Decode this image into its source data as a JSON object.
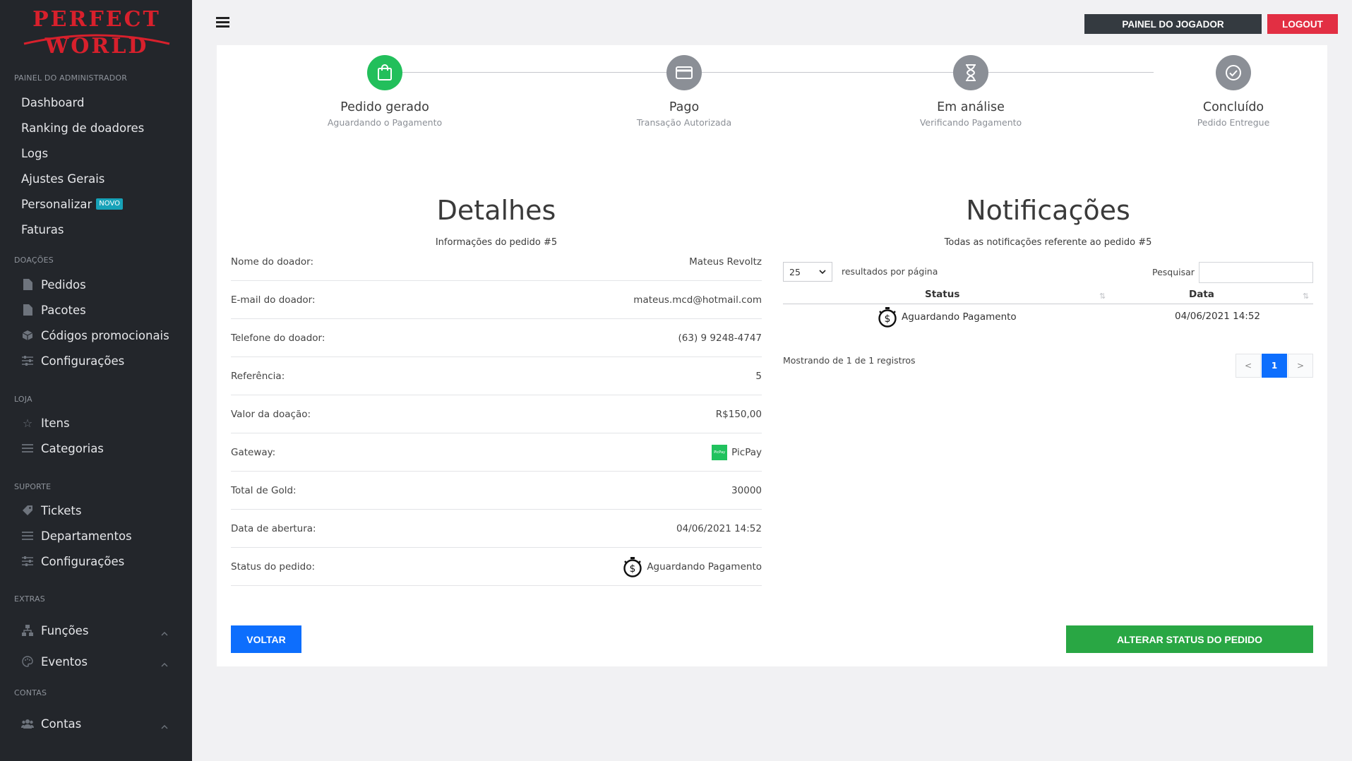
{
  "logo": {
    "line1": "PERFECT",
    "line2": "WORLD"
  },
  "sidebar": {
    "sections": {
      "admin": "PAINEL DO ADMINISTRADOR",
      "doacoes": "DOAÇÕES",
      "loja": "LOJA",
      "suporte": "SUPORTE",
      "extras": "EXTRAS",
      "contas": "CONTAS"
    },
    "admin_items": [
      "Dashboard",
      "Ranking de doadores",
      "Logs",
      "Ajustes Gerais",
      "Personalizar",
      "Faturas"
    ],
    "new_badge": "NOVO",
    "doacoes_items": [
      "Pedidos",
      "Pacotes",
      "Códigos promocionais",
      "Configurações"
    ],
    "loja_items": [
      "Itens",
      "Categorias"
    ],
    "suporte_items": [
      "Tickets",
      "Departamentos",
      "Configurações"
    ],
    "extras_items": [
      "Funções",
      "Eventos"
    ],
    "contas_items": [
      "Contas"
    ]
  },
  "topbar": {
    "player_panel": "PAINEL DO JOGADOR",
    "logout": "LOGOUT"
  },
  "steps": [
    {
      "title": "Pedido gerado",
      "subtitle": "Aguardando o Pagamento",
      "icon": "shopping-bag-icon",
      "active": true
    },
    {
      "title": "Pago",
      "subtitle": "Transação Autorizada",
      "icon": "credit-card-icon",
      "active": false
    },
    {
      "title": "Em análise",
      "subtitle": "Verificando Pagamento",
      "icon": "hourglass-icon",
      "active": false
    },
    {
      "title": "Concluído",
      "subtitle": "Pedido Entregue",
      "icon": "check-circle-icon",
      "active": false
    }
  ],
  "details": {
    "title": "Detalhes",
    "subtitle": "Informações do pedido #5",
    "rows": [
      {
        "label": "Nome do doador:",
        "value": "Mateus Revoltz"
      },
      {
        "label": "E-mail do doador:",
        "value": "mateus.mcd@hotmail.com"
      },
      {
        "label": "Telefone do doador:",
        "value": "(63) 9 9248-4747"
      },
      {
        "label": "Referência:",
        "value": "5"
      },
      {
        "label": "Valor da doação:",
        "value": "R$150,00"
      },
      {
        "label": "Gateway:",
        "value": "PicPay"
      },
      {
        "label": "Total de Gold:",
        "value": "30000"
      },
      {
        "label": "Data de abertura:",
        "value": "04/06/2021 14:52"
      },
      {
        "label": "Status do pedido:",
        "value": "Aguardando Pagamento"
      }
    ],
    "picpay_logo_text": "PicPay"
  },
  "notifications": {
    "title": "Notificações",
    "subtitle": "Todas as notificações referente ao pedido #5",
    "page_size": "25",
    "per_page_label": "resultados por página",
    "search_label": "Pesquisar",
    "search_value": "",
    "columns": [
      "Status",
      "Data"
    ],
    "rows": [
      {
        "status": "Aguardando Pagamento",
        "date": "04/06/2021 14:52"
      }
    ],
    "info": "Mostrando de 1 de 1 registros",
    "pager": {
      "prev": "<",
      "current": "1",
      "next": ">"
    }
  },
  "actions": {
    "back": "VOLTAR",
    "change_status": "ALTERAR STATUS DO PEDIDO"
  },
  "colors": {
    "sidebar_bg": "#23262b",
    "step_active": "#22bf5b",
    "step_inactive": "#8b8f96",
    "primary": "#0d6efd",
    "success": "#29a744",
    "danger": "#e22f43"
  }
}
